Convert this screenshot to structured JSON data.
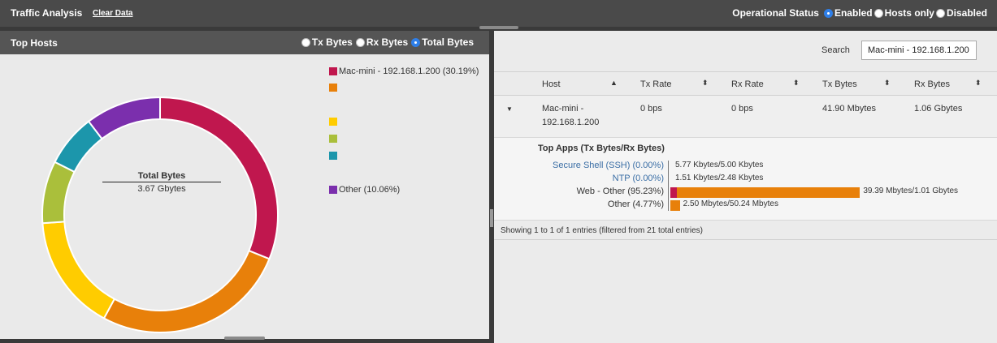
{
  "header": {
    "title": "Traffic Analysis",
    "clear_label": "Clear Data",
    "status_label": "Operational Status",
    "status_options": [
      {
        "label": "Enabled",
        "selected": true
      },
      {
        "label": "Hosts only",
        "selected": false
      },
      {
        "label": "Disabled",
        "selected": false
      }
    ]
  },
  "top_hosts": {
    "title": "Top Hosts",
    "options": [
      {
        "label": "Tx Bytes",
        "selected": false
      },
      {
        "label": "Rx Bytes",
        "selected": false
      },
      {
        "label": "Total Bytes",
        "selected": true
      }
    ],
    "center_title": "Total Bytes",
    "center_value": "3.67 Gbytes"
  },
  "chart_data": {
    "type": "pie",
    "donut": true,
    "categories": [
      "Mac-mini - 192.168.1.200 (30.19%)",
      "",
      "",
      "",
      "",
      "Other (10.06%)"
    ],
    "values": [
      30.19,
      26.0,
      15.5,
      8.3,
      7.0,
      10.06
    ],
    "colors": [
      "#c0174e",
      "#e8800a",
      "#ffcc00",
      "#aabf3b",
      "#1c96ab",
      "#7b2fad"
    ],
    "legend_position": "right"
  },
  "search": {
    "label": "Search",
    "value": "Mac-mini - 192.168.1.200"
  },
  "table": {
    "columns": [
      "Host",
      "Tx Rate",
      "Rx Rate",
      "Tx Bytes",
      "Rx Bytes"
    ],
    "rows": [
      {
        "host_line1": "Mac-mini -",
        "host_line2": "192.168.1.200",
        "tx_rate": "0 bps",
        "rx_rate": "0 bps",
        "tx_bytes": "41.90 Mbytes",
        "rx_bytes": "1.06 Gbytes"
      }
    ]
  },
  "top_apps": {
    "title": "Top Apps (Tx Bytes/Rx Bytes)",
    "apps": [
      {
        "name": "Secure Shell (SSH) (0.00%)",
        "value": "5.77 Kbytes/5.00 Kbytes",
        "percent": 0.0,
        "link": true,
        "tx_color": "#c0174e",
        "rx_color": "#e8800a"
      },
      {
        "name": "NTP (0.00%)",
        "value": "1.51 Kbytes/2.48 Kbytes",
        "percent": 0.0,
        "link": true,
        "tx_color": "#c0174e",
        "rx_color": "#e8800a"
      },
      {
        "name": "Web - Other (95.23%)",
        "value": "39.39 Mbytes/1.01 Gbytes",
        "percent": 95.23,
        "link": false,
        "tx_color": "#c0174e",
        "rx_color": "#e8800a"
      },
      {
        "name": "Other (4.77%)",
        "value": "2.50 Mbytes/50.24 Mbytes",
        "percent": 4.77,
        "link": false,
        "tx_color": "#c0174e",
        "rx_color": "#e8800a"
      }
    ]
  },
  "footer": {
    "info": "Showing 1 to 1 of 1 entries (filtered from 21 total entries)"
  }
}
